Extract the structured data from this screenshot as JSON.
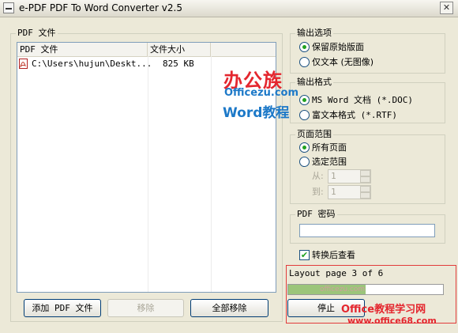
{
  "window": {
    "title": "e-PDF PDF To Word Converter v2.5",
    "close_glyph": "✕"
  },
  "file_group": {
    "legend": "PDF 文件",
    "columns": [
      "PDF 文件",
      "文件大小"
    ],
    "rows": [
      {
        "path": "C:\\Users\\hujun\\Deskt...",
        "size": "825 KB"
      }
    ]
  },
  "buttons": {
    "add": "添加 PDF 文件",
    "remove": "移除",
    "remove_all": "全部移除",
    "stop": "停止"
  },
  "output_options": {
    "legend": "输出选项",
    "options": [
      "保留原始版面",
      "仅文本 (无图像)"
    ],
    "selected": 0
  },
  "output_format": {
    "legend": "输出格式",
    "options": [
      "MS Word 文档 (*.DOC)",
      "富文本格式 (*.RTF)"
    ],
    "selected": 0
  },
  "page_range": {
    "legend": "页面范围",
    "options": [
      "所有页面",
      "选定范围"
    ],
    "selected": 0,
    "from_label": "从:",
    "from_value": "1",
    "to_label": "到:",
    "to_value": "1"
  },
  "password": {
    "legend": "PDF 密码",
    "value": ""
  },
  "view_after": {
    "label": "转换后查看",
    "checked": true,
    "check_glyph": "✔"
  },
  "status": {
    "text": "Layout page 3 of 6",
    "progress": 0.5
  },
  "watermarks": {
    "brand_cn": "办公族",
    "brand_url": "Officezu.com",
    "brand_word": "Word教程",
    "site_cn": "Office教程学习网",
    "site_url": "www.office68.com",
    "faint": "officezu.com"
  },
  "icons": [
    "app-menu-icon",
    "close-icon",
    "pdf-file-icon",
    "check-icon"
  ],
  "colors": {
    "accent_green": "#21a121",
    "progress_fill": "#9bc57a",
    "highlight_red": "#e23b3b"
  }
}
